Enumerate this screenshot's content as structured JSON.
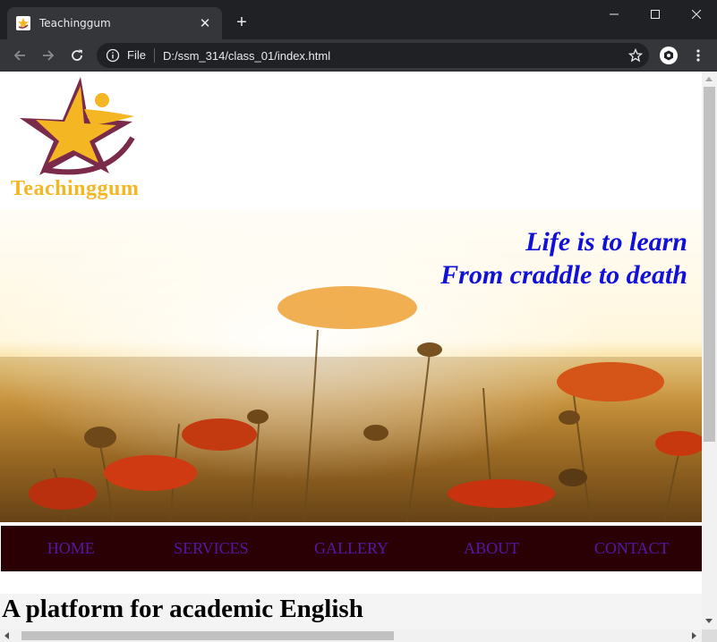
{
  "browser": {
    "tab_title": "Teachinggum",
    "tab_close_icon": "close-icon",
    "new_tab_icon": "plus-icon",
    "address_scheme": "File",
    "address_url": "D:/ssm_314/class_01/index.html",
    "window_controls": [
      "minimize-icon",
      "maximize-icon",
      "close-icon"
    ]
  },
  "page": {
    "logo_text": "Teachinggum",
    "hero_tagline_line1": "Life is to learn",
    "hero_tagline_line2": "From craddle to death",
    "nav": [
      {
        "label": "HOME"
      },
      {
        "label": "SERVICES"
      },
      {
        "label": "GALLERY"
      },
      {
        "label": "ABOUT"
      },
      {
        "label": "CONTACT"
      }
    ],
    "heading": "A platform for academic English"
  },
  "colors": {
    "tagline": "#1010d8",
    "navbar_bg": "#2b0004",
    "nav_link": "#5317a8",
    "logo_gold": "#f4b622",
    "logo_maroon": "#7a2a4a"
  }
}
